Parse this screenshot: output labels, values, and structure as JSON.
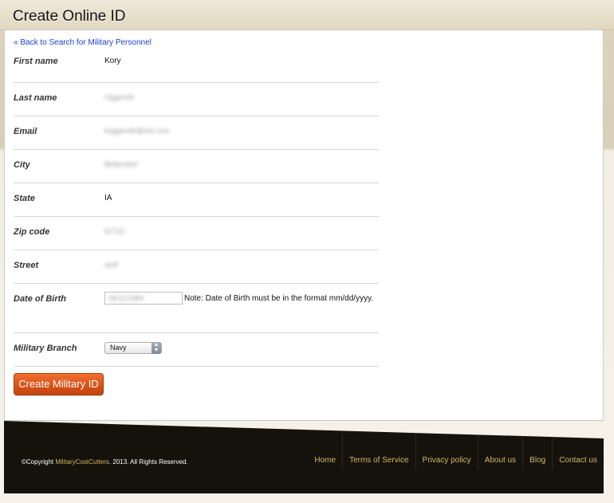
{
  "page": {
    "title": "Create Online ID",
    "back_link": "« Back to Search for Military Personnel"
  },
  "form": {
    "first_name_label": "First name",
    "first_name_value": "Kory",
    "last_name_label": "Last name",
    "last_name_value": "Oggeroth",
    "email_label": "Email",
    "email_value": "koggeroth@isis.com",
    "city_label": "City",
    "city_value": "Bettendorf",
    "state_label": "State",
    "state_value": "IA",
    "zip_label": "Zip code",
    "zip_value": "52722",
    "street_label": "Street",
    "street_value": "asdf",
    "dob_label": "Date of Birth",
    "dob_value": "06/11/1984",
    "dob_note": "Note: Date of Birth must be in the format mm/dd/yyyy.",
    "branch_label": "Military Branch",
    "branch_value": "Navy",
    "submit_label": "Create Military ID"
  },
  "footer": {
    "copyright_prefix": "©Copyright ",
    "brand": "MilitaryCostCutters",
    "copyright_suffix": ". 2013. All Rights Reserved.",
    "nav": [
      "Home",
      "Terms of Service",
      "Privacy policy",
      "About us",
      "Blog",
      "Contact us"
    ]
  },
  "colors": {
    "accent": "#d9531a",
    "footer_bg": "#15120c",
    "footer_link": "#d1b865",
    "link": "#1a3fd6"
  }
}
